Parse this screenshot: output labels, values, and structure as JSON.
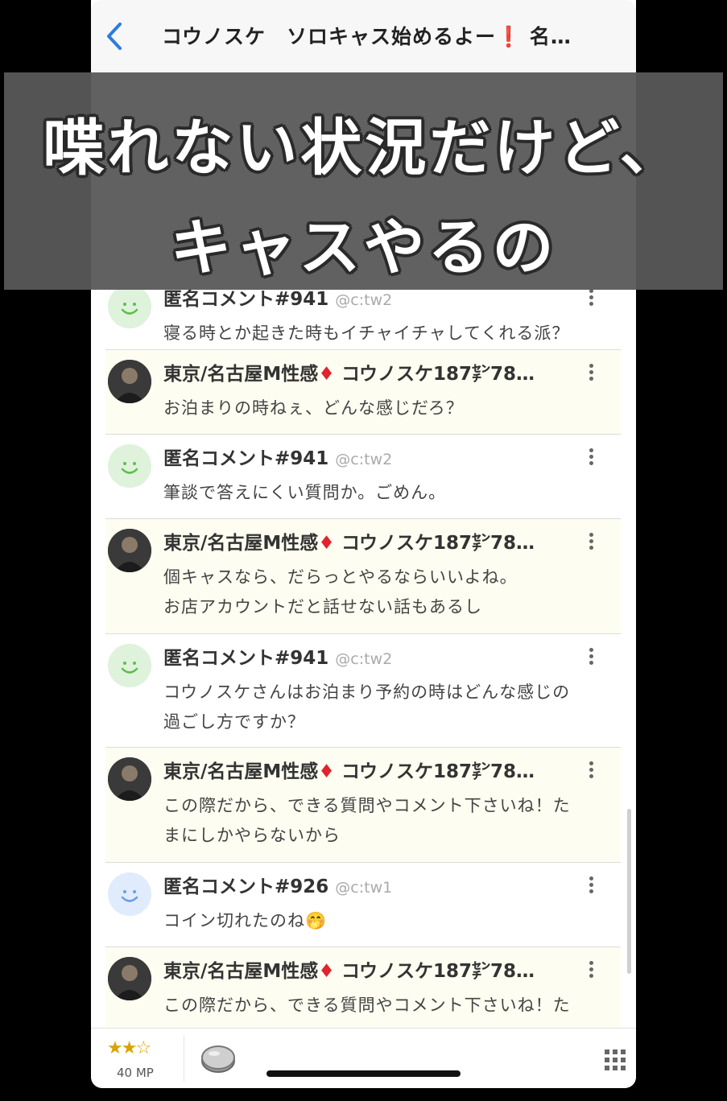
{
  "header": {
    "back_label": "<",
    "title": "コウノスケ　ソロキャス始めるよー❗ 名…"
  },
  "caption": {
    "line1": "喋れない状況だけど、",
    "line2": "キャスやるの"
  },
  "comments": [
    {
      "name": "匿名コメント#941",
      "handle": "@c:tw2",
      "text": "寝る時とか起きた時もイチャイチャしてくれる派？"
    },
    {
      "name_prefix": "東京/名古屋M性感",
      "diamond": "♦",
      "name_suffix": "コウノスケ187㌢78…",
      "text": "お泊まりの時ねぇ、どんな感じだろ？"
    },
    {
      "name": "匿名コメント#941",
      "handle": "@c:tw2",
      "text": "筆談で答えにくい質問か。ごめん。"
    },
    {
      "name_prefix": "東京/名古屋M性感",
      "diamond": "♦",
      "name_suffix": "コウノスケ187㌢78…",
      "text_line1": "個キャスなら、だらっとやるならいいよね。",
      "text_line2": "お店アカウントだと話せない話もあるし"
    },
    {
      "name": "匿名コメント#941",
      "handle": "@c:tw2",
      "text_line1": "コウノスケさんはお泊まり予約の時はどんな感じの",
      "text_line2": "過ごし方ですか？"
    },
    {
      "name_prefix": "東京/名古屋M性感",
      "diamond": "♦",
      "name_suffix": "コウノスケ187㌢78…",
      "text_line1": "この際だから、できる質問やコメント下さいね！た",
      "text_line2": "まにしかやらないから"
    },
    {
      "name": "匿名コメント#926",
      "handle": "@c:tw1",
      "text": "コイン切れたのね🤭"
    },
    {
      "name_prefix": "東京/名古屋M性感",
      "diamond": "♦",
      "name_suffix": "コウノスケ187㌢78…",
      "text": "この際だから、できる質問やコメント下さいね！た"
    }
  ],
  "bottom": {
    "stars": "★★☆",
    "mp": "40 MP"
  },
  "colors": {
    "accent": "#2a7de1",
    "host_row_bg": "#fdfdf1",
    "diamond": "#e0232e",
    "star": "#d9a400"
  }
}
